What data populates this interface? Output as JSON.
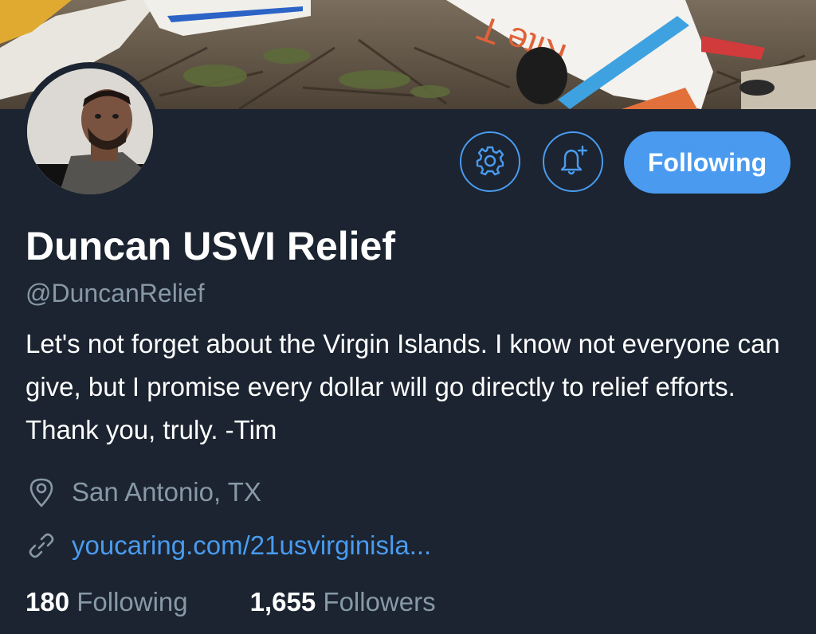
{
  "profile": {
    "display_name": "Duncan USVI Relief",
    "handle": "@DuncanRelief",
    "bio": "Let's not forget about the Virgin Islands. I know not everyone can give, but I promise every dollar will go directly to relief efforts. Thank you, truly. -Tim",
    "location": "San Antonio, TX",
    "website": "youcaring.com/21usvirginisla..."
  },
  "banner": {
    "painted_text": "Kite T"
  },
  "actions": {
    "settings_icon": "gear-icon",
    "notify_icon": "bell-plus-icon",
    "follow_label": "Following"
  },
  "meta_icons": {
    "location_icon": "map-pin-icon",
    "link_icon": "link-icon"
  },
  "stats": {
    "following_count": "180",
    "following_label": "Following",
    "followers_count": "1,655",
    "followers_label": "Followers"
  },
  "colors": {
    "background": "#1b2430",
    "accent": "#4a9bf0",
    "secondary_text": "#8899a6",
    "primary_text": "#ffffff"
  }
}
